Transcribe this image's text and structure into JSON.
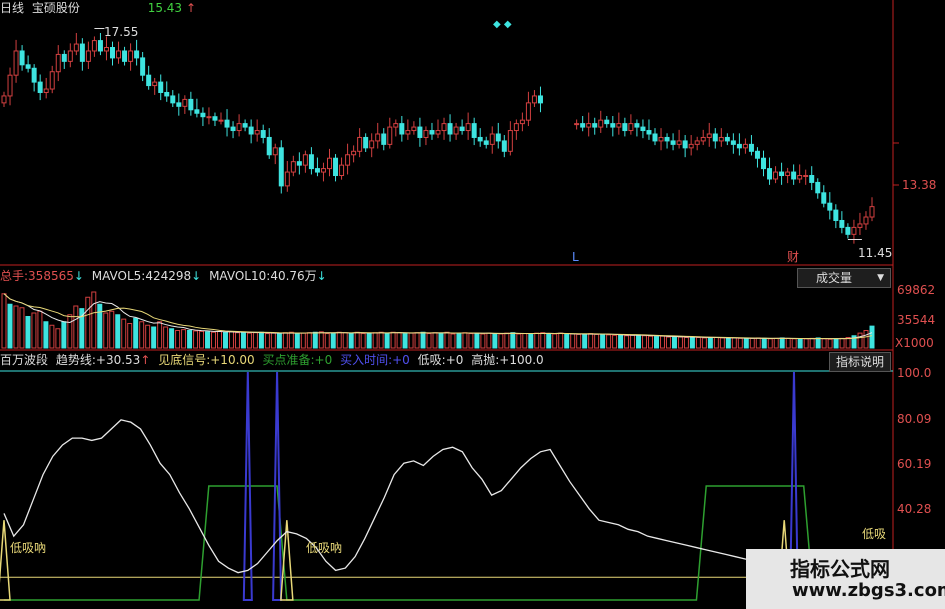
{
  "colors": {
    "up": "#d24040",
    "down": "#3ee4e0",
    "white": "#e8e8e8",
    "yellow": "#e8d878",
    "green": "#2ea030",
    "blue": "#3a3ad0",
    "magenta": "#d040d0",
    "axis": "#c02020",
    "labelred": "#e05050"
  },
  "header": {
    "period": "日线",
    "stock": "宝硕股份",
    "price": "15.43",
    "arrow": "↑"
  },
  "price_panel": {
    "high_label": "17.55",
    "low_label": "11.45",
    "axis_tick": "13.38",
    "marker_L": "L",
    "marker_cai": "财"
  },
  "volume_panel": {
    "total_label": "总手:",
    "total_value": "358565",
    "total_arrow": "↓",
    "mavol5_label": "MAVOL5:",
    "mavol5_value": "424298",
    "mavol5_arrow": "↓",
    "mavol10_label": "MAVOL10:",
    "mavol10_value": "40.76万",
    "mavol10_arrow": "↓",
    "button": "成交量",
    "button_arrow": "▼",
    "ticks": [
      "69862",
      "35544",
      "X1000"
    ]
  },
  "indicator_panel": {
    "name": "百万波段",
    "trend_label": "趋势线:",
    "trend_value": "+30.53",
    "trend_arrow": "↑",
    "bottom_label": "见底信号:",
    "bottom_value": "+10.00",
    "buy_prep_label": "买点准备:",
    "buy_prep_value": "+0",
    "buy_time_label": "买入时间:",
    "buy_time_value": "+0",
    "low_label": "低吸:",
    "low_value": "+0",
    "high_label": "高抛:",
    "high_value": "+100.0",
    "button": "指标说明",
    "ticks": [
      "100.0",
      "80.09",
      "60.19",
      "40.28"
    ],
    "annotations": [
      "低吸吶",
      "低吸吶",
      "低吸"
    ]
  },
  "watermark": {
    "line1": "指标公式网",
    "line2": "www.zbgs3.com"
  },
  "chart_data": [
    {
      "type": "candlestick",
      "title": "宝硕股份 日线",
      "ylim": [
        10.8,
        18.2
      ],
      "yticks": [
        13.38
      ],
      "segments": [
        [
          0,
          89
        ],
        [
          95,
          145
        ]
      ],
      "high_mark": {
        "index": 15,
        "value": 17.55
      },
      "low_mark": {
        "index": 140,
        "value": 11.45
      },
      "close": [
        15.6,
        16.2,
        16.9,
        16.5,
        16.4,
        16.0,
        15.7,
        15.8,
        16.3,
        16.8,
        16.6,
        16.9,
        17.1,
        16.6,
        16.9,
        17.2,
        16.9,
        17.0,
        16.7,
        16.9,
        16.6,
        16.9,
        16.7,
        16.2,
        15.9,
        16.0,
        15.7,
        15.6,
        15.4,
        15.3,
        15.5,
        15.2,
        15.1,
        15.0,
        15.0,
        14.9,
        14.9,
        14.7,
        14.6,
        14.8,
        14.7,
        14.5,
        14.6,
        14.4,
        13.9,
        14.1,
        13.0,
        13.4,
        13.7,
        13.6,
        13.9,
        13.5,
        13.4,
        13.5,
        13.8,
        13.3,
        13.6,
        13.9,
        14.0,
        14.4,
        14.1,
        14.3,
        14.5,
        14.2,
        14.7,
        14.8,
        14.5,
        14.6,
        14.7,
        14.4,
        14.6,
        14.5,
        14.6,
        14.8,
        14.5,
        14.7,
        14.6,
        14.8,
        14.4,
        14.3,
        14.2,
        14.5,
        14.3,
        14.0,
        14.6,
        14.8,
        14.9,
        15.4,
        15.6,
        15.4,
        14.9,
        14.8,
        14.7,
        14.9,
        14.8,
        14.8,
        14.7,
        14.8,
        14.7,
        14.9,
        14.8,
        14.7,
        14.8,
        14.6,
        14.8,
        14.7,
        14.6,
        14.5,
        14.3,
        14.4,
        14.3,
        14.2,
        14.3,
        14.1,
        14.2,
        14.3,
        14.4,
        14.5,
        14.3,
        14.4,
        14.3,
        14.2,
        14.1,
        14.2,
        14.0,
        13.8,
        13.5,
        13.2,
        13.4,
        13.3,
        13.4,
        13.2,
        13.3,
        13.3,
        13.1,
        12.8,
        12.5,
        12.3,
        12.0,
        11.8,
        11.6,
        11.8,
        11.9,
        12.1,
        12.4
      ]
    },
    {
      "type": "bar",
      "title": "成交量",
      "ylim": [
        0,
        80000
      ],
      "yticks": [
        69862,
        35544
      ],
      "values": [
        62000,
        50000,
        48000,
        46000,
        36000,
        40000,
        42000,
        30000,
        26000,
        22000,
        30000,
        38000,
        48000,
        45000,
        58000,
        64000,
        50000,
        40000,
        42000,
        38000,
        33000,
        28000,
        34000,
        30000,
        26000,
        24000,
        30000,
        24000,
        22000,
        20000,
        21000,
        20000,
        19500,
        19000,
        18500,
        18000,
        19000,
        18000,
        18500,
        17500,
        18000,
        17000,
        17500,
        18000,
        16500,
        17000,
        16000,
        17500,
        18000,
        16500,
        17000,
        17500,
        18000,
        18500,
        16500,
        17000,
        18000,
        17500,
        17000,
        18000,
        16500,
        17000,
        17500,
        18000,
        17000,
        18000,
        17500,
        16500,
        17000,
        17500,
        18000,
        16500,
        17500,
        17000,
        18000,
        16000,
        17000,
        17500,
        16500,
        17000,
        16000,
        17000,
        16500,
        16000,
        17000,
        17500,
        16000,
        16500,
        16000,
        17000,
        17500,
        16500,
        16000,
        17000,
        15500,
        16000,
        15500,
        16000,
        16500,
        15500,
        16000,
        15000,
        14500,
        15000,
        14000,
        14500,
        15000,
        14000,
        13500,
        13000,
        13500,
        12500,
        13000,
        12500,
        12000,
        12500,
        12000,
        11500,
        12000,
        12000,
        11500,
        11000,
        11500,
        11000,
        10500,
        11000,
        11500,
        11000,
        10500,
        11000,
        11500,
        11000,
        10500,
        10000,
        10500,
        11000,
        11500,
        10500,
        10000,
        10500,
        11000,
        12000,
        14000,
        17000,
        20000,
        25000
      ]
    },
    {
      "type": "line",
      "title": "百万波段",
      "ylim": [
        0,
        100
      ],
      "yticks": [
        100.0,
        80.09,
        60.19,
        40.28
      ],
      "series": [
        {
          "name": "趋势线",
          "values": [
            38,
            28,
            33,
            44,
            55,
            63,
            68,
            71,
            71,
            70,
            71,
            75,
            79,
            78,
            75,
            68,
            60,
            55,
            47,
            40,
            32,
            24,
            17,
            14,
            12,
            13,
            16,
            21,
            26,
            30,
            29,
            27,
            23,
            17,
            13,
            14,
            19,
            27,
            36,
            45,
            55,
            60,
            61,
            59,
            63,
            66,
            67,
            65,
            58,
            53,
            46,
            48,
            53,
            58,
            62,
            65,
            66,
            59,
            52,
            46,
            40,
            35,
            34,
            33,
            31,
            30,
            28,
            27,
            26,
            25,
            24,
            23,
            22,
            21,
            20,
            19,
            18,
            17,
            16,
            16,
            15,
            16,
            17,
            16,
            15,
            14,
            13,
            12,
            11,
            10
          ]
        },
        {
          "name": "高抛",
          "values": [
            0,
            0,
            0,
            0,
            0,
            0,
            0,
            0,
            0,
            0,
            0,
            0,
            0,
            0,
            0,
            0,
            0,
            0,
            0,
            0,
            0,
            0,
            0,
            0,
            0,
            100,
            0,
            0,
            100,
            0,
            0,
            0,
            0,
            0,
            0,
            0,
            0,
            0,
            0,
            0,
            0,
            0,
            0,
            0,
            0,
            0,
            0,
            0,
            0,
            0,
            0,
            0,
            0,
            0,
            0,
            0,
            0,
            0,
            0,
            0,
            0,
            0,
            0,
            0,
            0,
            0,
            0,
            0,
            0,
            0,
            0,
            0,
            0,
            0,
            0,
            0,
            0,
            0,
            0,
            0,
            0,
            100,
            0,
            0,
            0,
            0,
            0,
            0,
            0,
            0
          ]
        },
        {
          "name": "买点准备",
          "values": [
            0,
            0,
            0,
            0,
            0,
            0,
            0,
            0,
            0,
            0,
            0,
            0,
            0,
            0,
            0,
            0,
            0,
            0,
            0,
            0,
            0,
            50,
            50,
            50,
            50,
            50,
            50,
            50,
            50,
            0,
            0,
            0,
            0,
            0,
            0,
            0,
            0,
            0,
            0,
            0,
            0,
            0,
            0,
            0,
            0,
            0,
            0,
            0,
            0,
            0,
            0,
            0,
            0,
            0,
            0,
            0,
            0,
            0,
            0,
            0,
            0,
            0,
            0,
            0,
            0,
            0,
            0,
            0,
            0,
            0,
            0,
            0,
            50,
            50,
            50,
            50,
            50,
            50,
            50,
            50,
            50,
            50,
            50,
            0,
            0,
            0,
            0,
            0,
            0,
            0
          ]
        },
        {
          "name": "低吸",
          "values": [
            35,
            0,
            0,
            0,
            0,
            0,
            0,
            0,
            0,
            0,
            0,
            0,
            0,
            0,
            0,
            0,
            0,
            0,
            0,
            0,
            0,
            0,
            0,
            0,
            0,
            0,
            0,
            0,
            0,
            35,
            0,
            0,
            0,
            0,
            0,
            0,
            0,
            0,
            0,
            0,
            0,
            0,
            0,
            0,
            0,
            0,
            0,
            0,
            0,
            0,
            0,
            0,
            0,
            0,
            0,
            0,
            0,
            0,
            0,
            0,
            0,
            0,
            0,
            0,
            0,
            0,
            0,
            0,
            0,
            0,
            0,
            0,
            0,
            0,
            0,
            0,
            0,
            0,
            0,
            0,
            35,
            0,
            0,
            0,
            0,
            0,
            0,
            0,
            0,
            0
          ]
        }
      ]
    }
  ]
}
